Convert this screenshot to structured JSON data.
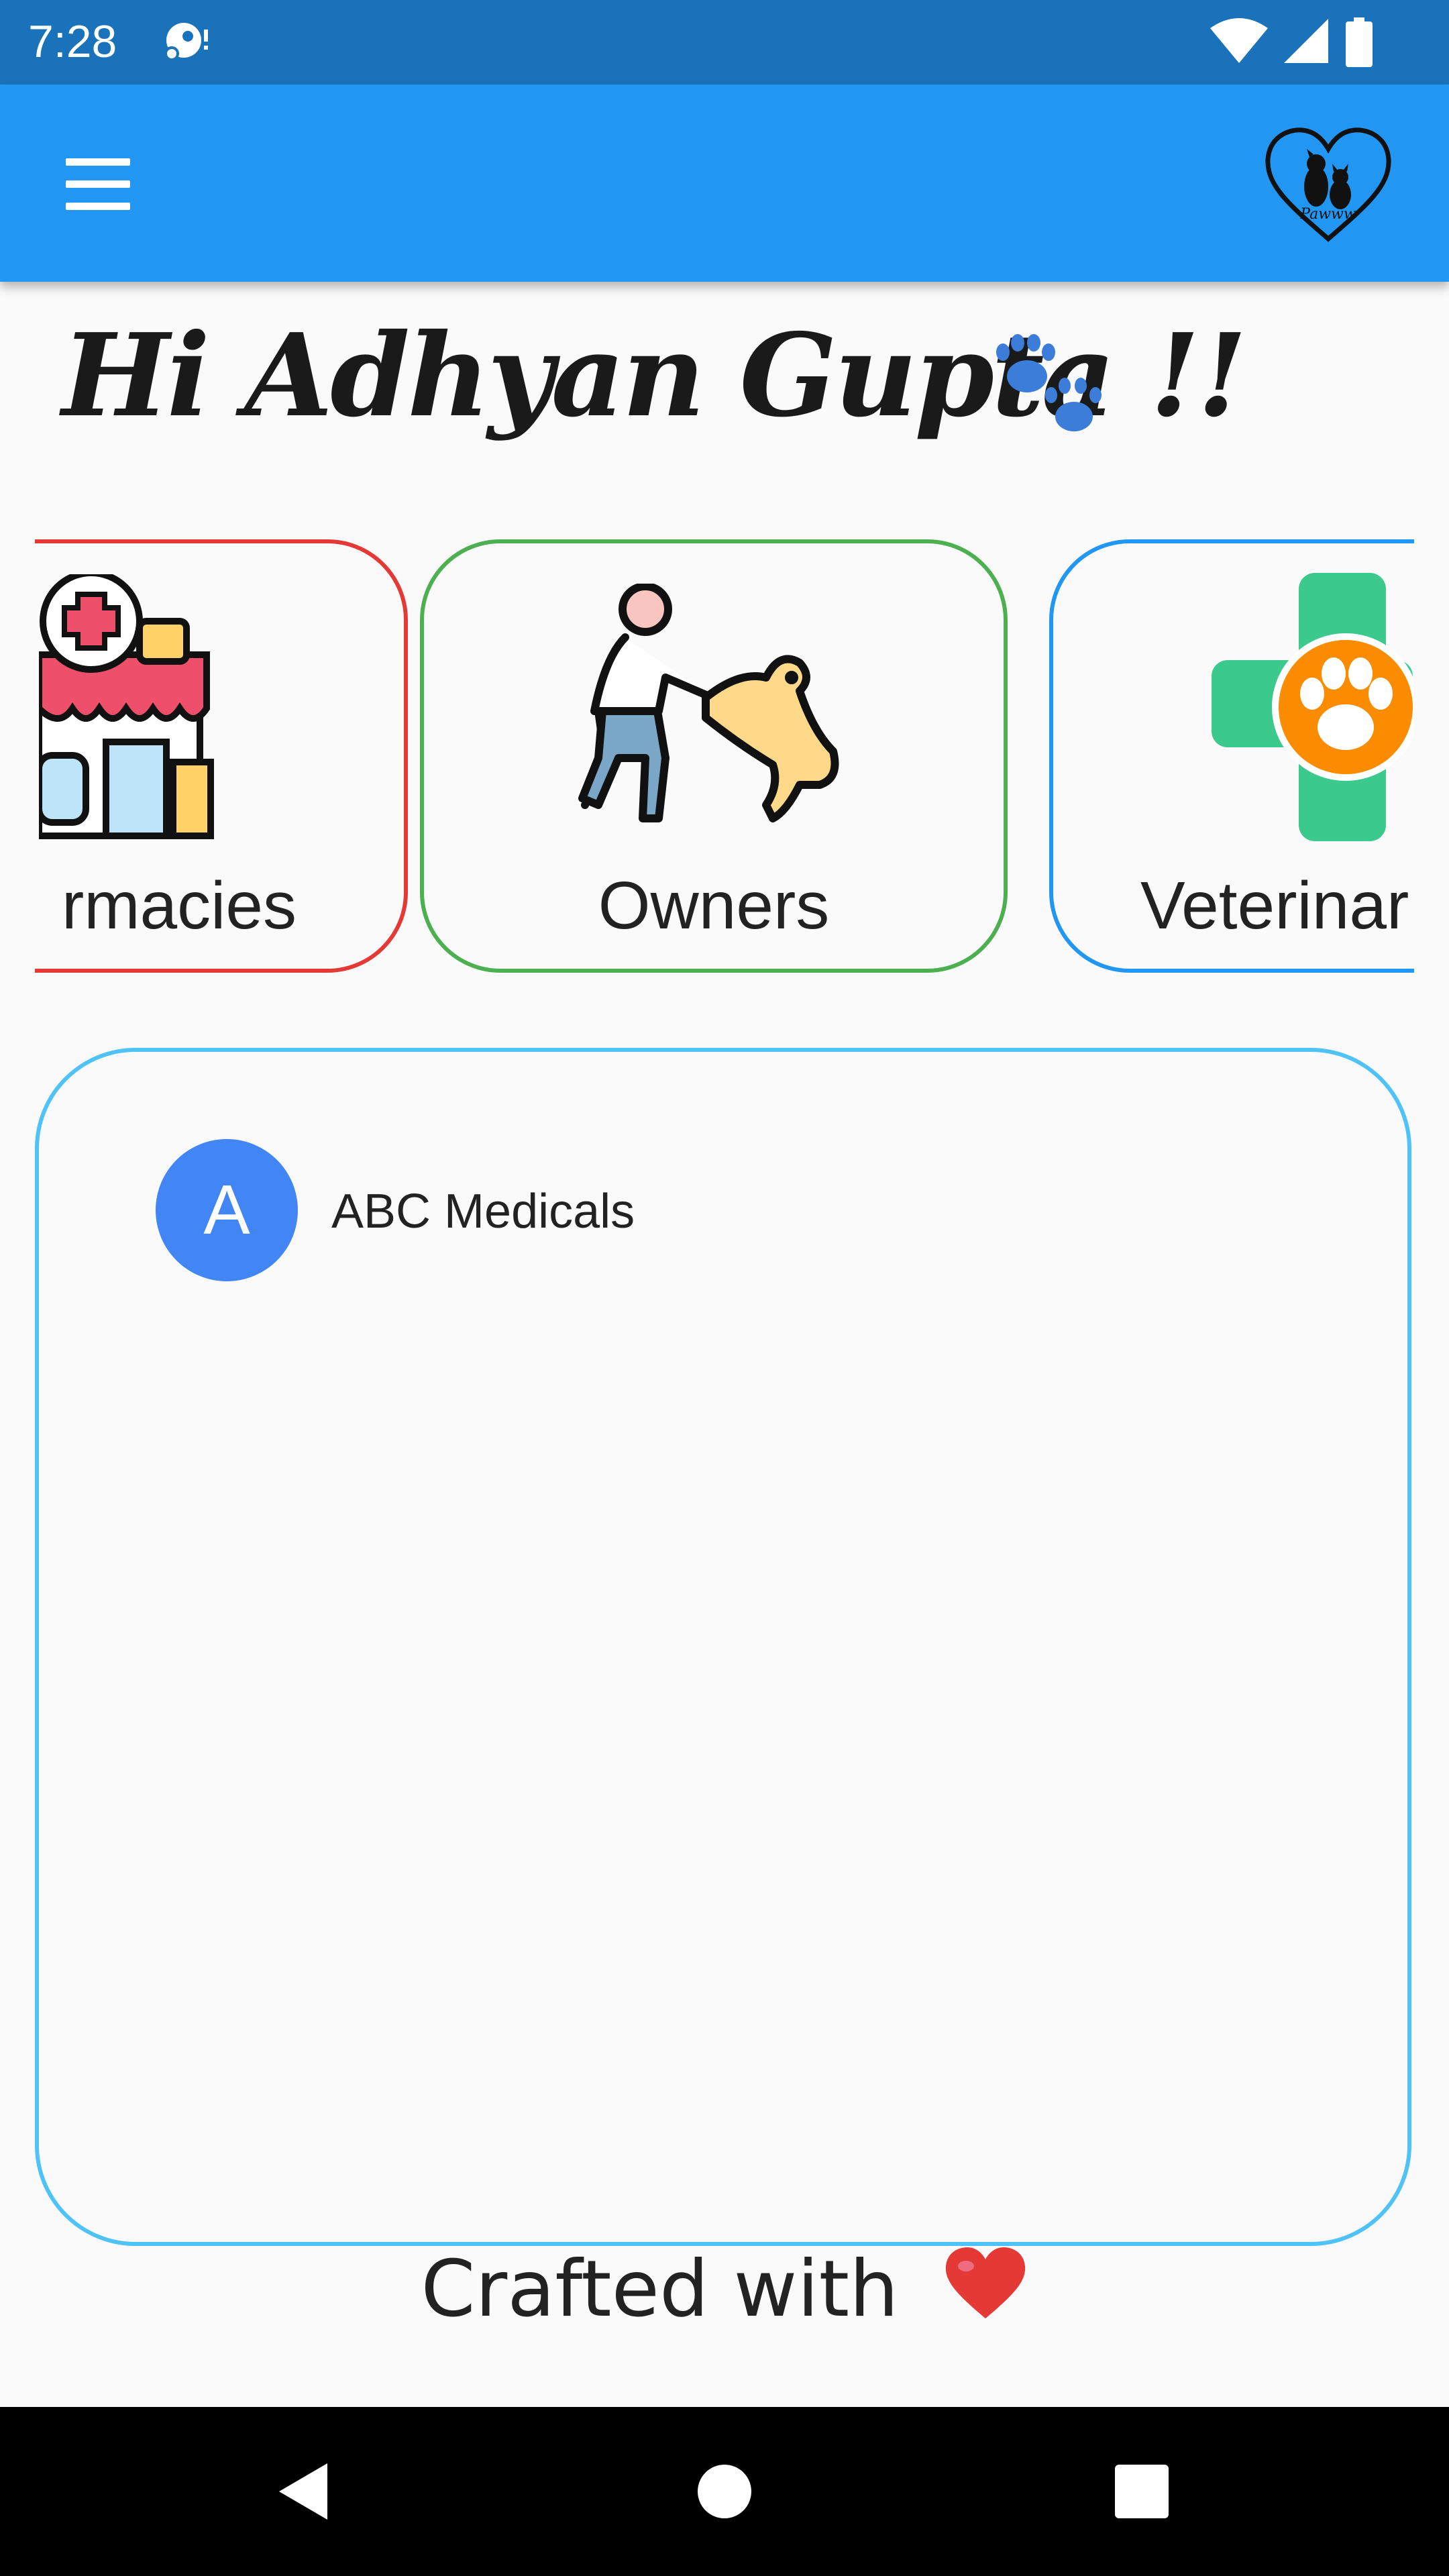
{
  "status_bar": {
    "time": "7:28",
    "left_icon": "media-notification-icon",
    "right_icons": [
      "wifi-icon",
      "cellular-signal-icon",
      "battery-icon"
    ]
  },
  "app_bar": {
    "menu_icon": "hamburger-menu-icon",
    "logo_text": "Pawww"
  },
  "greeting": {
    "text": "Hi Adhyan Gupta !!",
    "emoji": "paw-prints-icon"
  },
  "categories": [
    {
      "label": "rmacies",
      "icon": "pharmacy-store-icon",
      "border_color": "#e53935"
    },
    {
      "label": "Owners",
      "icon": "person-playing-with-dog-icon",
      "border_color": "#4caf50"
    },
    {
      "label": "Veterinar",
      "icon": "vet-cross-paw-icon",
      "border_color": "#2196f3"
    }
  ],
  "list": {
    "items": [
      {
        "avatar_letter": "A",
        "title": "ABC Medicals"
      }
    ]
  },
  "footer": {
    "text": "Crafted with",
    "icon": "heart-icon"
  },
  "nav_bar": {
    "buttons": [
      "back-triangle-icon",
      "home-circle-icon",
      "recents-square-icon"
    ]
  },
  "colors": {
    "status_bar": "#1a73ba",
    "app_bar": "#2196f3",
    "list_border": "#4fc3f7",
    "avatar": "#4285f4"
  }
}
